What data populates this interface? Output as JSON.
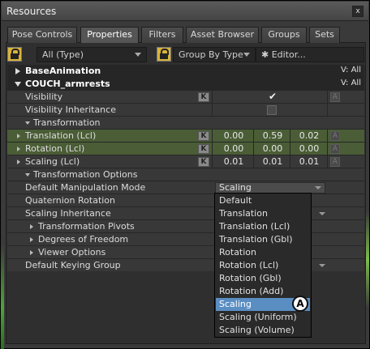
{
  "window": {
    "title": "Resources",
    "close_label": "x"
  },
  "tabs": [
    {
      "label": "Pose Controls",
      "active": false
    },
    {
      "label": "Properties",
      "active": true
    },
    {
      "label": "Filters",
      "active": false
    },
    {
      "label": "Asset Browser",
      "active": false
    },
    {
      "label": "Groups",
      "active": false
    },
    {
      "label": "Sets",
      "active": false
    }
  ],
  "toolbar": {
    "filter_value": "All (Type)",
    "group_value": "Group By Type",
    "editor_label": "✱ Editor..."
  },
  "rows": {
    "base_animation": {
      "label": "BaseAnimation",
      "v": "V: All"
    },
    "couch": {
      "label": "COUCH_armrests",
      "v": "V: All"
    },
    "visibility": {
      "label": "Visibility",
      "k": "K",
      "checked": true
    },
    "visibility_inheritance": {
      "label": "Visibility Inheritance",
      "checked": false
    },
    "transformation": {
      "label": "Transformation"
    },
    "translation": {
      "label": "Translation (Lcl)",
      "k": "K",
      "values": [
        "0.00",
        "0.59",
        "0.02"
      ],
      "a": "A"
    },
    "rotation": {
      "label": "Rotation (Lcl)",
      "k": "K",
      "values": [
        "0.00",
        "0.00",
        "0.00"
      ],
      "a": "A"
    },
    "scaling": {
      "label": "Scaling (Lcl)",
      "k": "K",
      "values": [
        "0.01",
        "0.01",
        "0.01"
      ],
      "a": "A"
    },
    "visibility_a": "A",
    "transformation_options": {
      "label": "Transformation Options"
    },
    "manipulation_mode": {
      "label": "Default Manipulation Mode",
      "value": "Scaling"
    },
    "quaternion": {
      "label": "Quaternion Rotation"
    },
    "scaling_inheritance": {
      "label": "Scaling Inheritance"
    },
    "pivots": {
      "label": "Transformation Pivots"
    },
    "dof": {
      "label": "Degrees of Freedom"
    },
    "viewer_options": {
      "label": "Viewer Options"
    },
    "keying_group": {
      "label": "Default Keying Group"
    }
  },
  "dropdown": {
    "options": [
      "Default",
      "Translation",
      "Translation (Lcl)",
      "Translation (Gbl)",
      "Rotation",
      "Rotation (Lcl)",
      "Rotation (Gbl)",
      "Rotation (Add)",
      "Scaling",
      "Scaling (Uniform)",
      "Scaling (Volume)"
    ],
    "selected": "Scaling"
  },
  "callout": {
    "label": "A"
  },
  "colors": {
    "selection": "#5a8ec2",
    "green_row": "#4a5d36",
    "accent_glow": "#4fa33a"
  }
}
